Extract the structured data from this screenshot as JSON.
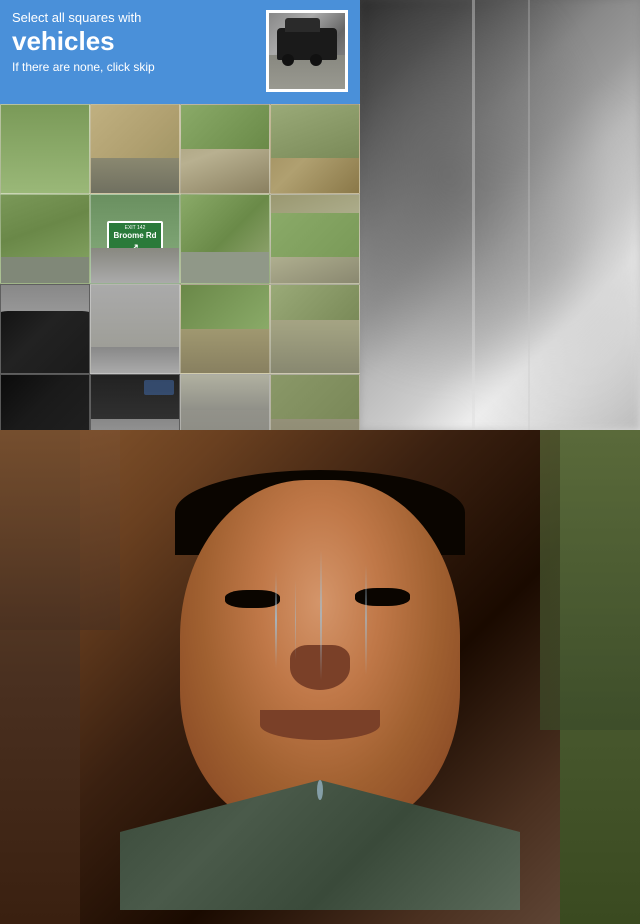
{
  "captcha": {
    "select_text": "Select all squares with",
    "main_word": "vehicles",
    "skip_text": "If there are none, click skip",
    "thumbnail_alt": "vehicle reference image",
    "grid_size": "4x4",
    "accent_color": "#4a90d9"
  },
  "sign": {
    "exit": "EXIT 142",
    "road": "Broome Rd",
    "arrow": "↗"
  },
  "bottom_image": {
    "description": "crying man face close-up"
  }
}
